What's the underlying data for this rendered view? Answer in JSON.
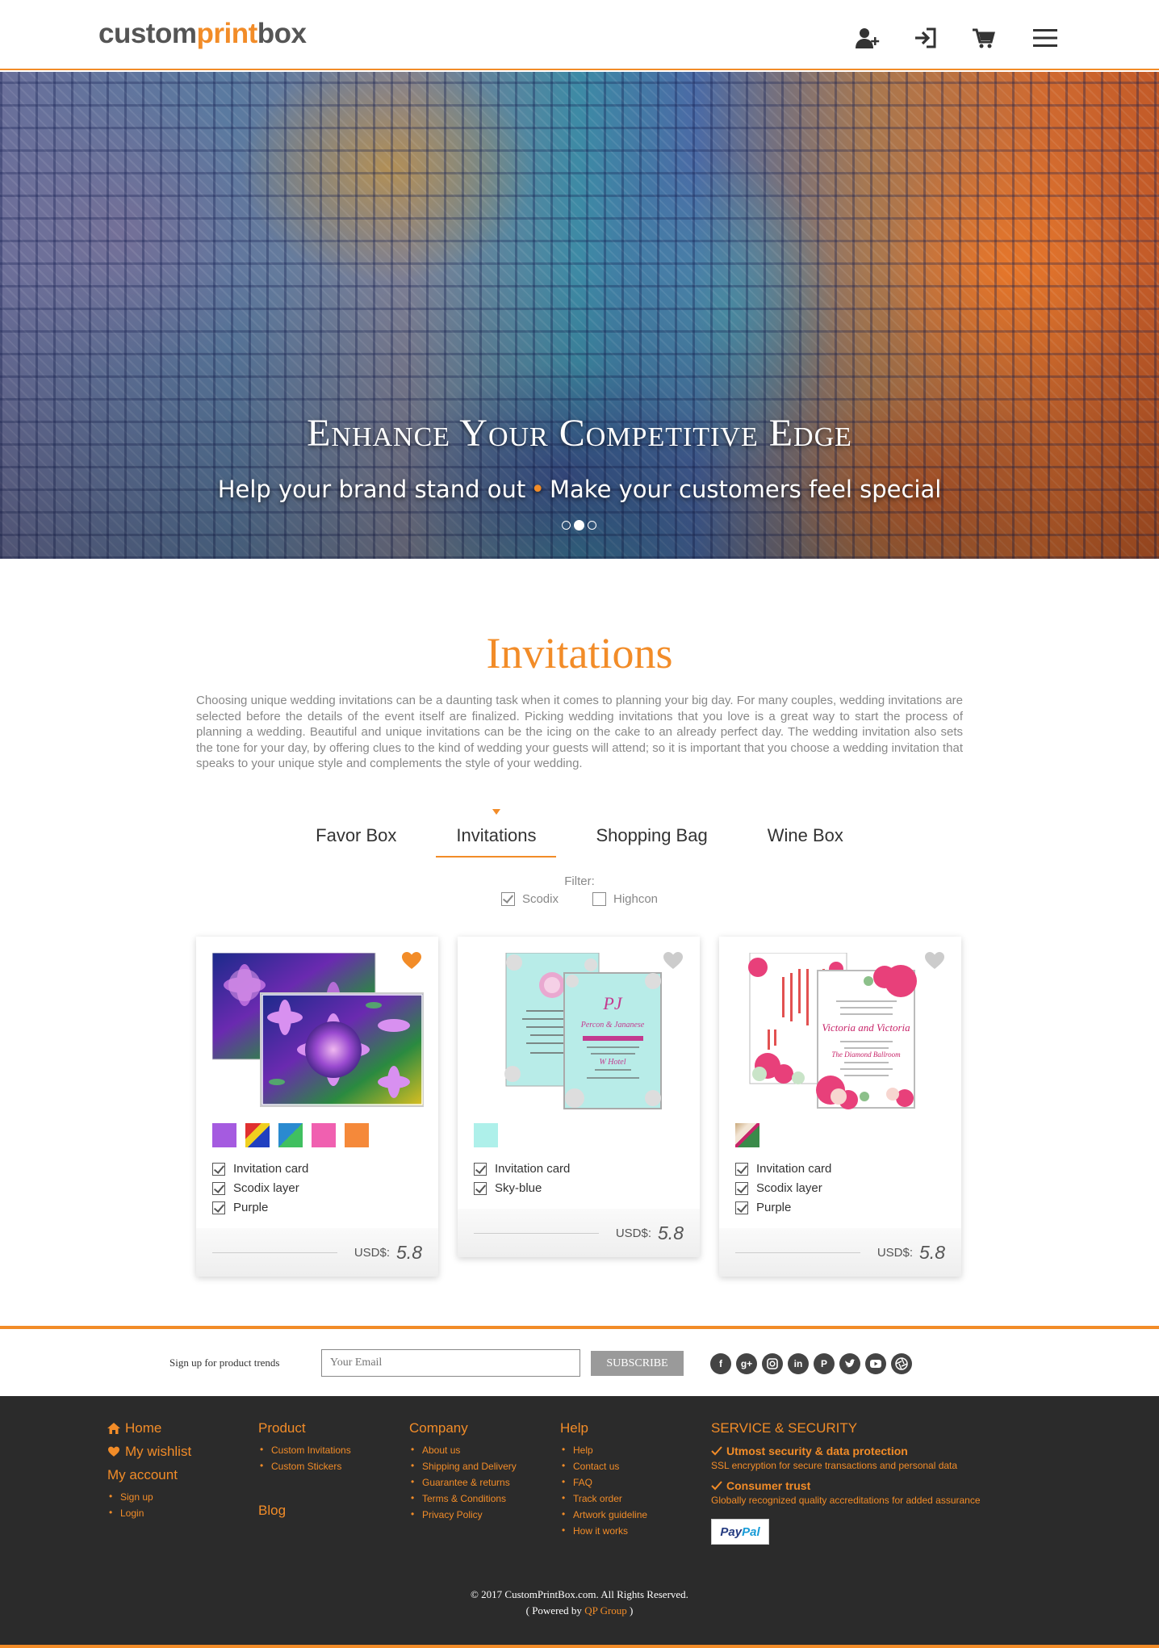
{
  "header": {
    "logo_part1": "custom",
    "logo_part2": "print",
    "logo_part3": "box",
    "icons": [
      "add-user-icon",
      "login-icon",
      "cart-icon",
      "menu-icon"
    ]
  },
  "hero": {
    "title": "Enhance Your Competitive Edge",
    "subtitle_left": "Help your brand stand out",
    "subtitle_sep": "•",
    "subtitle_right": "Make your customers feel special",
    "slides": 3,
    "active_slide": 2
  },
  "section": {
    "title": "Invitations",
    "description": "Choosing unique wedding invitations can be a daunting task when it comes to planning your big day. For many couples, wedding invitations are selected before the details of the event itself are finalized. Picking wedding invitations that you love is a great way to start the process of planning a wedding. Beautiful and unique invitations can be the icing on the cake to an already perfect day. The wedding invitation also sets the tone for your day, by offering clues to the kind of wedding your guests will attend; so it is important that you choose a wedding invitation that speaks to your unique style and complements the style of your wedding."
  },
  "tabs": [
    {
      "label": "Favor Box",
      "active": false
    },
    {
      "label": "Invitations",
      "active": true
    },
    {
      "label": "Shopping Bag",
      "active": false
    },
    {
      "label": "Wine Box",
      "active": false
    }
  ],
  "filter": {
    "label": "Filter:",
    "options": [
      {
        "label": "Scodix",
        "checked": true
      },
      {
        "label": "Highcon",
        "checked": false
      }
    ]
  },
  "products": [
    {
      "favorited": true,
      "swatches": [
        "#a55be0",
        "multi-yellow-red-blue",
        "multi-blue-green",
        "#f060b0",
        "#f5893a"
      ],
      "features": [
        "Invitation card",
        "Scodix layer",
        "Purple"
      ],
      "price_label": "USD$:",
      "price": "5.8"
    },
    {
      "favorited": false,
      "swatches": [
        "#aef0ea"
      ],
      "features": [
        "Invitation card",
        "Sky-blue"
      ],
      "price_label": "USD$:",
      "price": "5.8"
    },
    {
      "favorited": false,
      "swatches": [
        "floral-cream-red-green"
      ],
      "features": [
        "Invitation card",
        "Scodix layer",
        "Purple"
      ],
      "price_label": "USD$:",
      "price": "5.8"
    }
  ],
  "subscribe": {
    "label": "Sign up for product trends",
    "placeholder": "Your Email",
    "button": "SUBSCRIBE",
    "socials": [
      "facebook-icon",
      "google-plus-icon",
      "instagram-icon",
      "linkedin-icon",
      "pinterest-icon",
      "twitter-icon",
      "youtube-icon",
      "camera-shutter-icon"
    ]
  },
  "footer": {
    "home": "Home",
    "wishlist": "My wishlist",
    "account": "My account",
    "account_links": [
      "Sign up",
      "Login"
    ],
    "product_head": "Product",
    "product_links": [
      "Custom Invitations",
      "Custom Stickers"
    ],
    "blog": "Blog",
    "company_head": "Company",
    "company_links": [
      "About us",
      "Shipping and Delivery",
      "Guarantee & returns",
      "Terms & Conditions",
      "Privacy Policy"
    ],
    "help_head": "Help",
    "help_links": [
      "Help",
      "Contact us",
      "FAQ",
      "Track order",
      "Artwork guideline",
      "How it works"
    ],
    "security_head": "SERVICE & SECURITY",
    "security_items": [
      {
        "title": "Utmost security & data protection",
        "text": "SSL encryption for secure transactions and personal data"
      },
      {
        "title": "Consumer trust",
        "text": "Globally recognized quality accreditations for added assurance"
      }
    ],
    "paypal_1": "Pay",
    "paypal_2": "Pal",
    "copyright": "© 2017 CustomPrintBox.com. All Rights Reserved.",
    "powered_prefix": "( Powered by ",
    "powered_link": "QP Group",
    "powered_suffix": " )"
  }
}
